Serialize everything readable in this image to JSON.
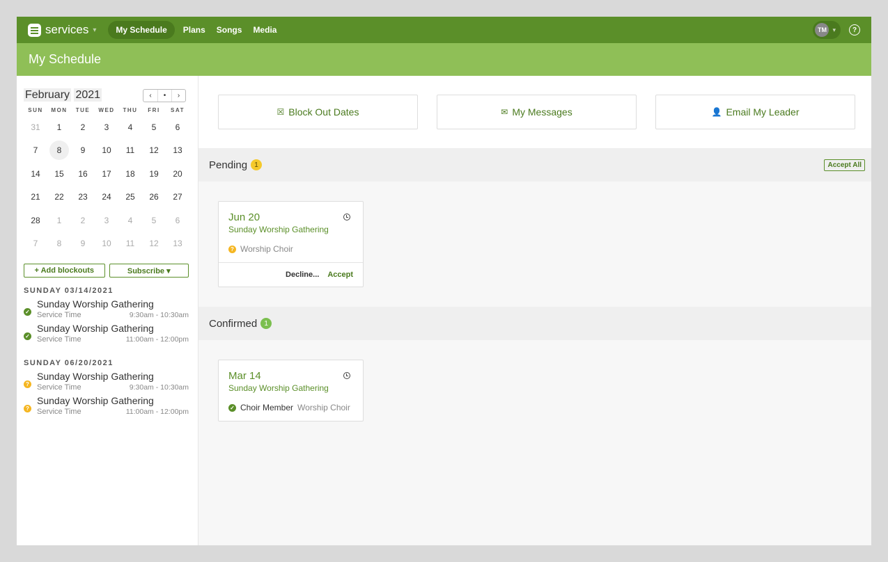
{
  "nav": {
    "app_name": "services",
    "items": [
      "My Schedule",
      "Plans",
      "Songs",
      "Media"
    ],
    "avatar_initials": "TM",
    "help_icon": "?"
  },
  "page_title": "My Schedule",
  "calendar": {
    "month": "February",
    "year": "2021",
    "nav": [
      "‹",
      "•",
      "›"
    ],
    "weekdays": [
      "SUN",
      "MON",
      "TUE",
      "WED",
      "THU",
      "FRI",
      "SAT"
    ],
    "days": [
      {
        "d": "31",
        "muted": true
      },
      {
        "d": "1"
      },
      {
        "d": "2"
      },
      {
        "d": "3"
      },
      {
        "d": "4"
      },
      {
        "d": "5"
      },
      {
        "d": "6"
      },
      {
        "d": "7"
      },
      {
        "d": "8",
        "today": true
      },
      {
        "d": "9"
      },
      {
        "d": "10"
      },
      {
        "d": "11"
      },
      {
        "d": "12"
      },
      {
        "d": "13"
      },
      {
        "d": "14"
      },
      {
        "d": "15"
      },
      {
        "d": "16"
      },
      {
        "d": "17"
      },
      {
        "d": "18"
      },
      {
        "d": "19"
      },
      {
        "d": "20"
      },
      {
        "d": "21"
      },
      {
        "d": "22"
      },
      {
        "d": "23"
      },
      {
        "d": "24"
      },
      {
        "d": "25"
      },
      {
        "d": "26"
      },
      {
        "d": "27"
      },
      {
        "d": "28"
      },
      {
        "d": "1",
        "muted": true
      },
      {
        "d": "2",
        "muted": true
      },
      {
        "d": "3",
        "muted": true
      },
      {
        "d": "4",
        "muted": true
      },
      {
        "d": "5",
        "muted": true
      },
      {
        "d": "6",
        "muted": true
      },
      {
        "d": "7",
        "muted": true
      },
      {
        "d": "8",
        "muted": true
      },
      {
        "d": "9",
        "muted": true
      },
      {
        "d": "10",
        "muted": true
      },
      {
        "d": "11",
        "muted": true
      },
      {
        "d": "12",
        "muted": true
      },
      {
        "d": "13",
        "muted": true
      }
    ]
  },
  "sidebar": {
    "add_blockouts": "+ Add blockouts",
    "subscribe": "Subscribe ▾",
    "schedule": [
      {
        "day": "SUNDAY 03/14/2021",
        "items": [
          {
            "status": "confirmed",
            "title": "Sunday Worship Gathering",
            "sub": "Service Time",
            "time": "9:30am - 10:30am"
          },
          {
            "status": "confirmed",
            "title": "Sunday Worship Gathering",
            "sub": "Service Time",
            "time": "11:00am - 12:00pm"
          }
        ]
      },
      {
        "day": "SUNDAY 06/20/2021",
        "items": [
          {
            "status": "pending",
            "title": "Sunday Worship Gathering",
            "sub": "Service Time",
            "time": "9:30am - 10:30am"
          },
          {
            "status": "pending",
            "title": "Sunday Worship Gathering",
            "sub": "Service Time",
            "time": "11:00am - 12:00pm"
          }
        ]
      }
    ]
  },
  "actions": {
    "block_out": {
      "label": "Block Out Dates",
      "icon": "calendar-x-icon"
    },
    "messages": {
      "label": "My Messages",
      "icon": "envelope-icon"
    },
    "email_leader": {
      "label": "Email My Leader",
      "icon": "person-icon"
    }
  },
  "pending": {
    "title": "Pending",
    "count": "1",
    "accept_all": "Accept All",
    "card": {
      "date": "Jun 20",
      "event": "Sunday Worship Gathering",
      "role": "Worship Choir",
      "decline": "Decline...",
      "accept": "Accept"
    }
  },
  "confirmed": {
    "title": "Confirmed",
    "count": "1",
    "card": {
      "date": "Mar 14",
      "event": "Sunday Worship Gathering",
      "role": "Choir Member",
      "team": "Worship Choir"
    }
  },
  "colors": {
    "brand": "#5b8f29",
    "brand_light": "#8fbf57",
    "pending": "#f5c92b"
  }
}
